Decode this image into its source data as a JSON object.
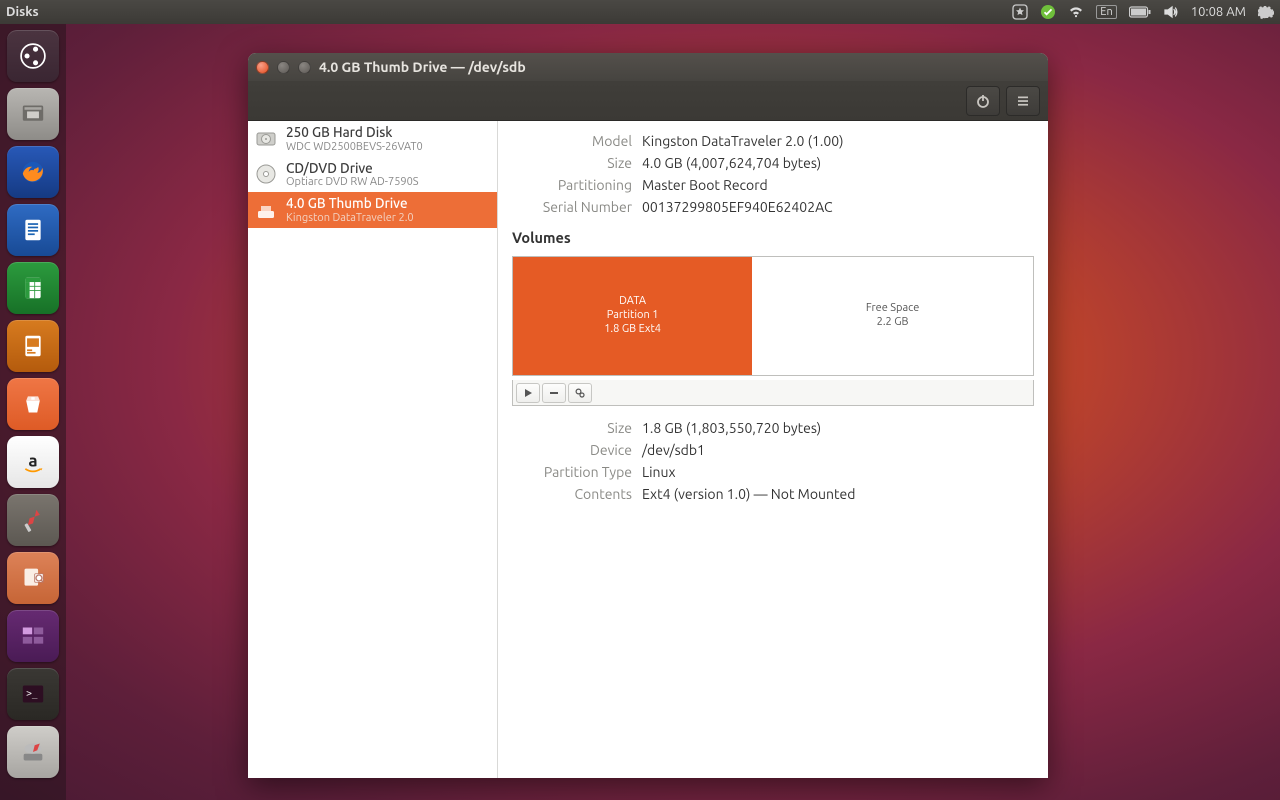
{
  "menubar": {
    "app_title": "Disks",
    "lang": "En",
    "clock": "10:08 AM"
  },
  "window": {
    "title": "4.0 GB Thumb Drive — /dev/sdb"
  },
  "sidebar": {
    "items": [
      {
        "title": "250 GB Hard Disk",
        "subtitle": "WDC WD2500BEVS-26VAT0",
        "selected": false,
        "name": "drive-hdd"
      },
      {
        "title": "CD/DVD Drive",
        "subtitle": "Optiarc DVD RW AD-7590S",
        "selected": false,
        "name": "drive-optical"
      },
      {
        "title": "4.0 GB Thumb Drive",
        "subtitle": "Kingston DataTraveler 2.0",
        "selected": true,
        "name": "drive-usb"
      }
    ]
  },
  "info": {
    "model_k": "Model",
    "model_v": "Kingston DataTraveler 2.0 (1.00)",
    "size_k": "Size",
    "size_v": "4.0 GB (4,007,624,704 bytes)",
    "part_k": "Partitioning",
    "part_v": "Master Boot Record",
    "sn_k": "Serial Number",
    "sn_v": "00137299805EF940E62402AC"
  },
  "volumes_label": "Volumes",
  "volumes": {
    "seg_data": {
      "title": "DATA",
      "sub1": "Partition 1",
      "sub2": "1.8 GB Ext4"
    },
    "seg_free": {
      "title": "Free Space",
      "sub1": "2.2 GB"
    }
  },
  "selvol": {
    "size_k": "Size",
    "size_v": "1.8 GB (1,803,550,720 bytes)",
    "device_k": "Device",
    "device_v": "/dev/sdb1",
    "ptype_k": "Partition Type",
    "ptype_v": "Linux",
    "contents_k": "Contents",
    "contents_v": "Ext4 (version 1.0) — Not Mounted"
  }
}
